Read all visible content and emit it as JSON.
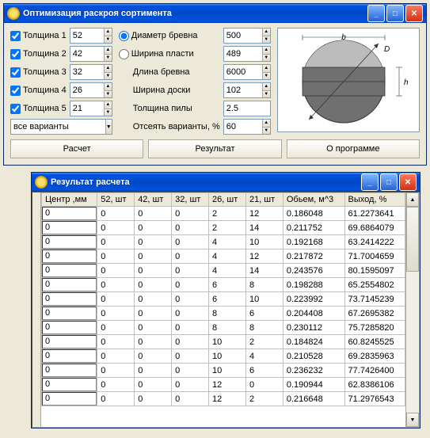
{
  "config": {
    "title": "Оптимизация раскроя сортимента",
    "thickness_labels": [
      "Толщина 1",
      "Толщина 2",
      "Толщина 3",
      "Толщина 4",
      "Толщина 5"
    ],
    "thickness_values": [
      "52",
      "42",
      "32",
      "26",
      "21"
    ],
    "diameter_label": "Диаметр бревна",
    "diameter_value": "500",
    "width_plain_label": "Ширина пласти",
    "width_plain_value": "489",
    "length_label": "Длина бревна",
    "length_value": "6000",
    "board_width_label": "Ширина доски",
    "board_width_value": "102",
    "saw_label": "Толщина пилы",
    "saw_value": "2.5",
    "cut_variants_label": "Отсеять варианты, %",
    "cut_variants_value": "60",
    "combo_value": "все варианты",
    "btn_calc": "Расчет",
    "btn_result": "Результат",
    "btn_about": "О программе"
  },
  "result": {
    "title": "Результат расчета",
    "headers": [
      "Центр ,мм",
      "52, шт",
      "42, шт",
      "32, шт",
      "26, шт",
      "21, шт",
      "Обьем, м^3",
      "Выход, %"
    ]
  },
  "chart_data": {
    "type": "table",
    "columns": [
      "Центр ,мм",
      "52, шт",
      "42, шт",
      "32, шт",
      "26, шт",
      "21, шт",
      "Обьем, м^3",
      "Выход, %"
    ],
    "rows": [
      [
        "0",
        "0",
        "0",
        "0",
        "2",
        "12",
        "0.186048",
        "61.2273641"
      ],
      [
        "0",
        "0",
        "0",
        "0",
        "2",
        "14",
        "0.211752",
        "69.6864079"
      ],
      [
        "0",
        "0",
        "0",
        "0",
        "4",
        "10",
        "0.192168",
        "63.2414222"
      ],
      [
        "0",
        "0",
        "0",
        "0",
        "4",
        "12",
        "0.217872",
        "71.7004659"
      ],
      [
        "0",
        "0",
        "0",
        "0",
        "4",
        "14",
        "0.243576",
        "80.1595097"
      ],
      [
        "0",
        "0",
        "0",
        "0",
        "6",
        "8",
        "0.198288",
        "65.2554802"
      ],
      [
        "0",
        "0",
        "0",
        "0",
        "6",
        "10",
        "0.223992",
        "73.7145239"
      ],
      [
        "0",
        "0",
        "0",
        "0",
        "8",
        "6",
        "0.204408",
        "67.2695382"
      ],
      [
        "0",
        "0",
        "0",
        "0",
        "8",
        "8",
        "0.230112",
        "75.7285820"
      ],
      [
        "0",
        "0",
        "0",
        "0",
        "10",
        "2",
        "0.184824",
        "60.8245525"
      ],
      [
        "0",
        "0",
        "0",
        "0",
        "10",
        "4",
        "0.210528",
        "69.2835963"
      ],
      [
        "0",
        "0",
        "0",
        "0",
        "10",
        "6",
        "0.236232",
        "77.7426400"
      ],
      [
        "0",
        "0",
        "0",
        "0",
        "12",
        "0",
        "0.190944",
        "62.8386106"
      ],
      [
        "0",
        "0",
        "0",
        "0",
        "12",
        "2",
        "0.216648",
        "71.2976543"
      ]
    ]
  }
}
